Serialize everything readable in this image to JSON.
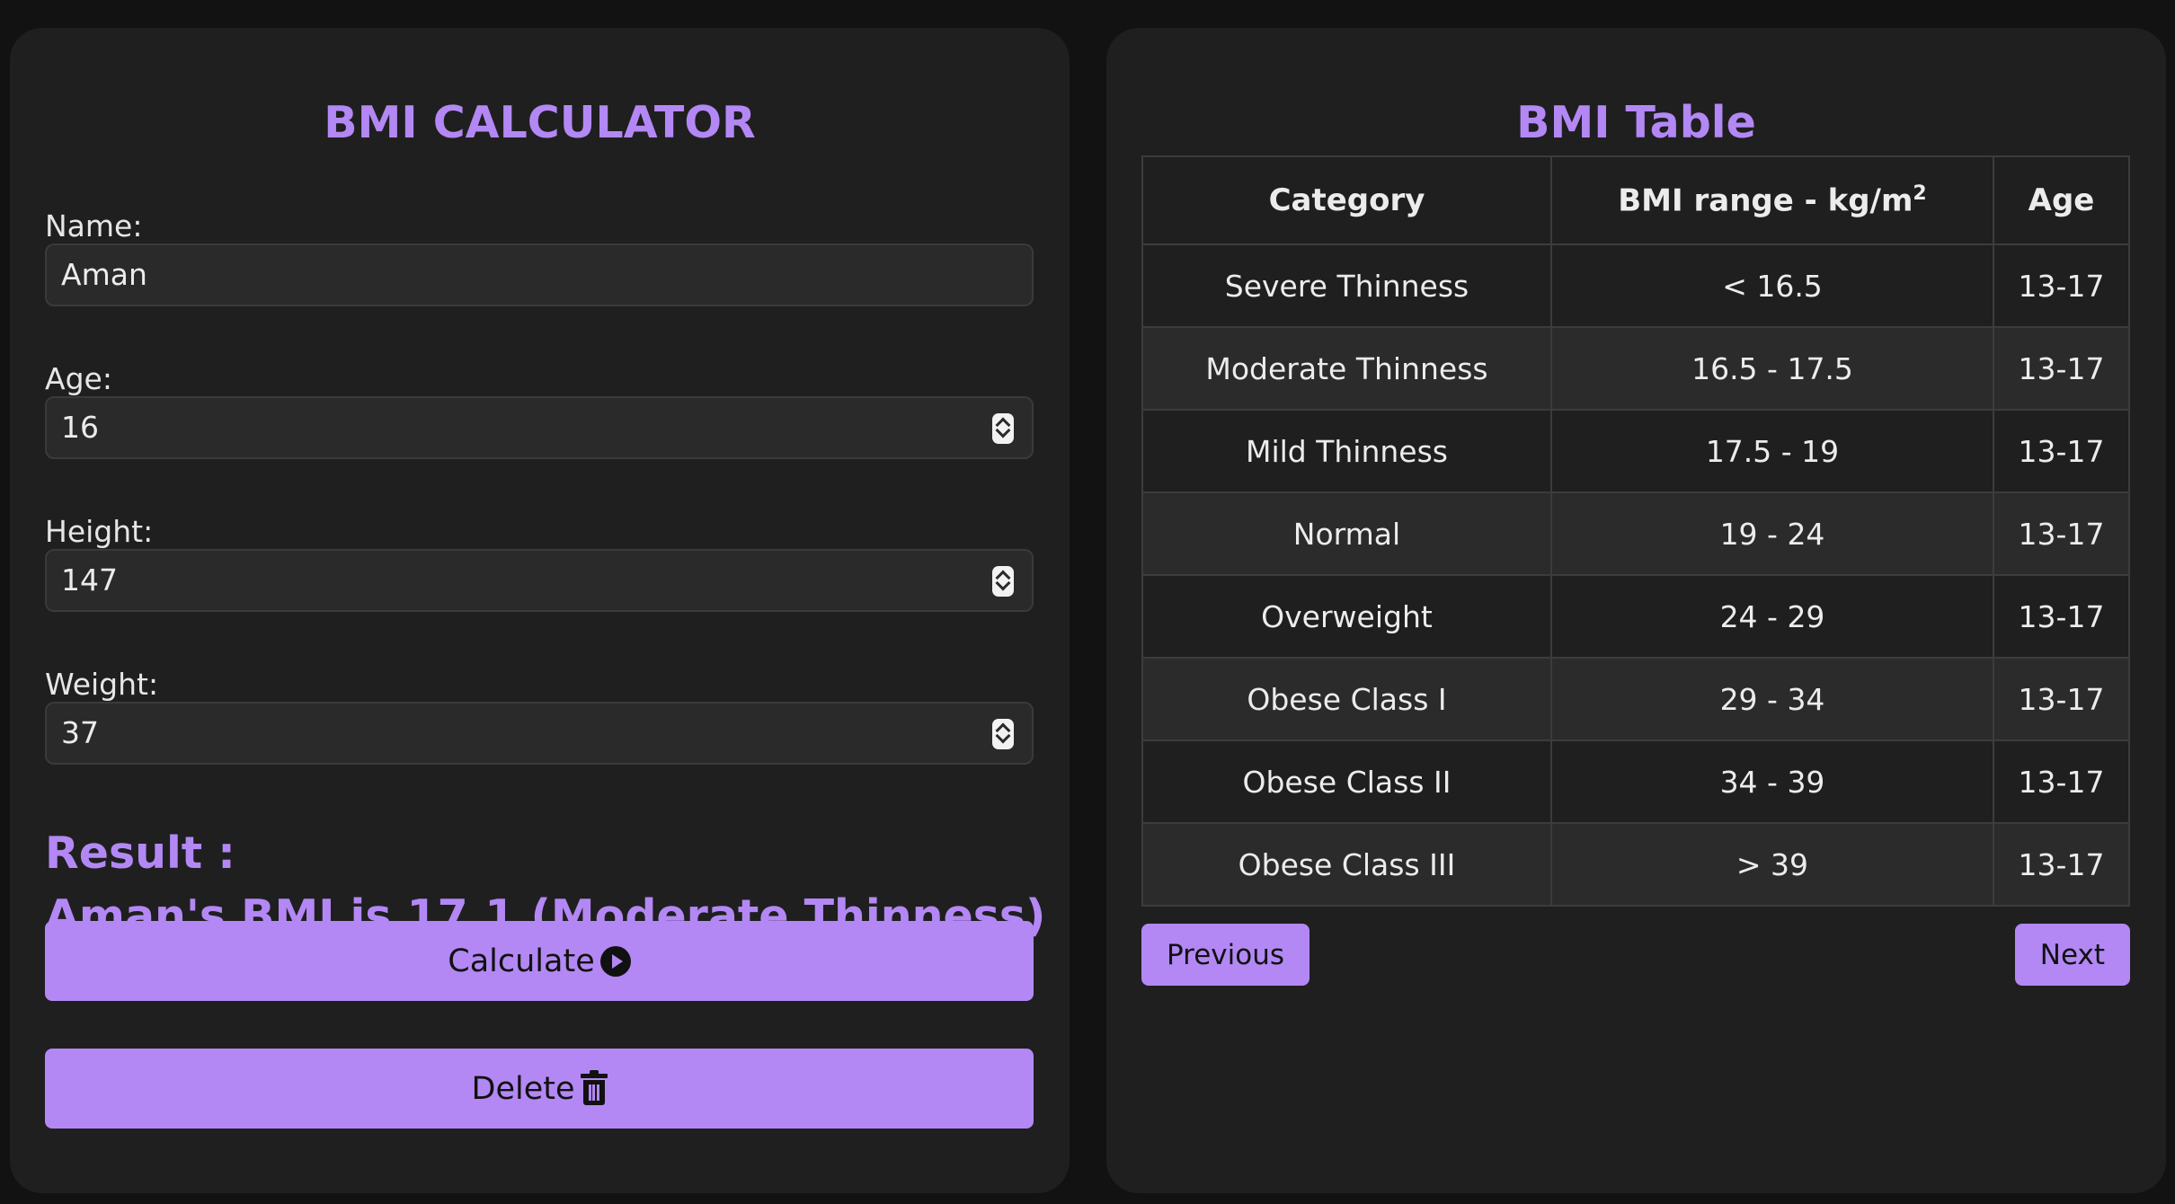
{
  "calculator": {
    "title": "BMI CALCULATOR",
    "fields": [
      {
        "label": "Name:",
        "value": "Aman"
      },
      {
        "label": "Age:",
        "value": "16"
      },
      {
        "label": "Height:",
        "value": "147"
      },
      {
        "label": "Weight:",
        "value": "37"
      }
    ],
    "result_label": "Result :",
    "result_text": "Aman's BMI is 17.1 (Moderate Thinness)",
    "calculate_label": "Calculate",
    "delete_label": "Delete"
  },
  "table": {
    "title": "BMI Table",
    "headers": {
      "category": "Category",
      "range_prefix": "BMI range - kg/m",
      "range_sup": "2",
      "age": "Age"
    },
    "rows": [
      {
        "category": "Severe Thinness",
        "range": "< 16.5",
        "age": "13-17"
      },
      {
        "category": "Moderate Thinness",
        "range": "16.5 - 17.5",
        "age": "13-17"
      },
      {
        "category": "Mild Thinness",
        "range": "17.5 - 19",
        "age": "13-17"
      },
      {
        "category": "Normal",
        "range": "19 - 24",
        "age": "13-17"
      },
      {
        "category": "Overweight",
        "range": "24 - 29",
        "age": "13-17"
      },
      {
        "category": "Obese Class I",
        "range": "29 - 34",
        "age": "13-17"
      },
      {
        "category": "Obese Class II",
        "range": "34 - 39",
        "age": "13-17"
      },
      {
        "category": "Obese Class III",
        "range": "> 39",
        "age": "13-17"
      }
    ],
    "previous_label": "Previous",
    "next_label": "Next"
  },
  "icons": {
    "calculate": "play-circle-icon",
    "delete": "trash-icon",
    "stepper": "stepper-icon"
  },
  "colors": {
    "accent": "#b388f4",
    "panel": "#1f1f20",
    "background": "#121212"
  }
}
